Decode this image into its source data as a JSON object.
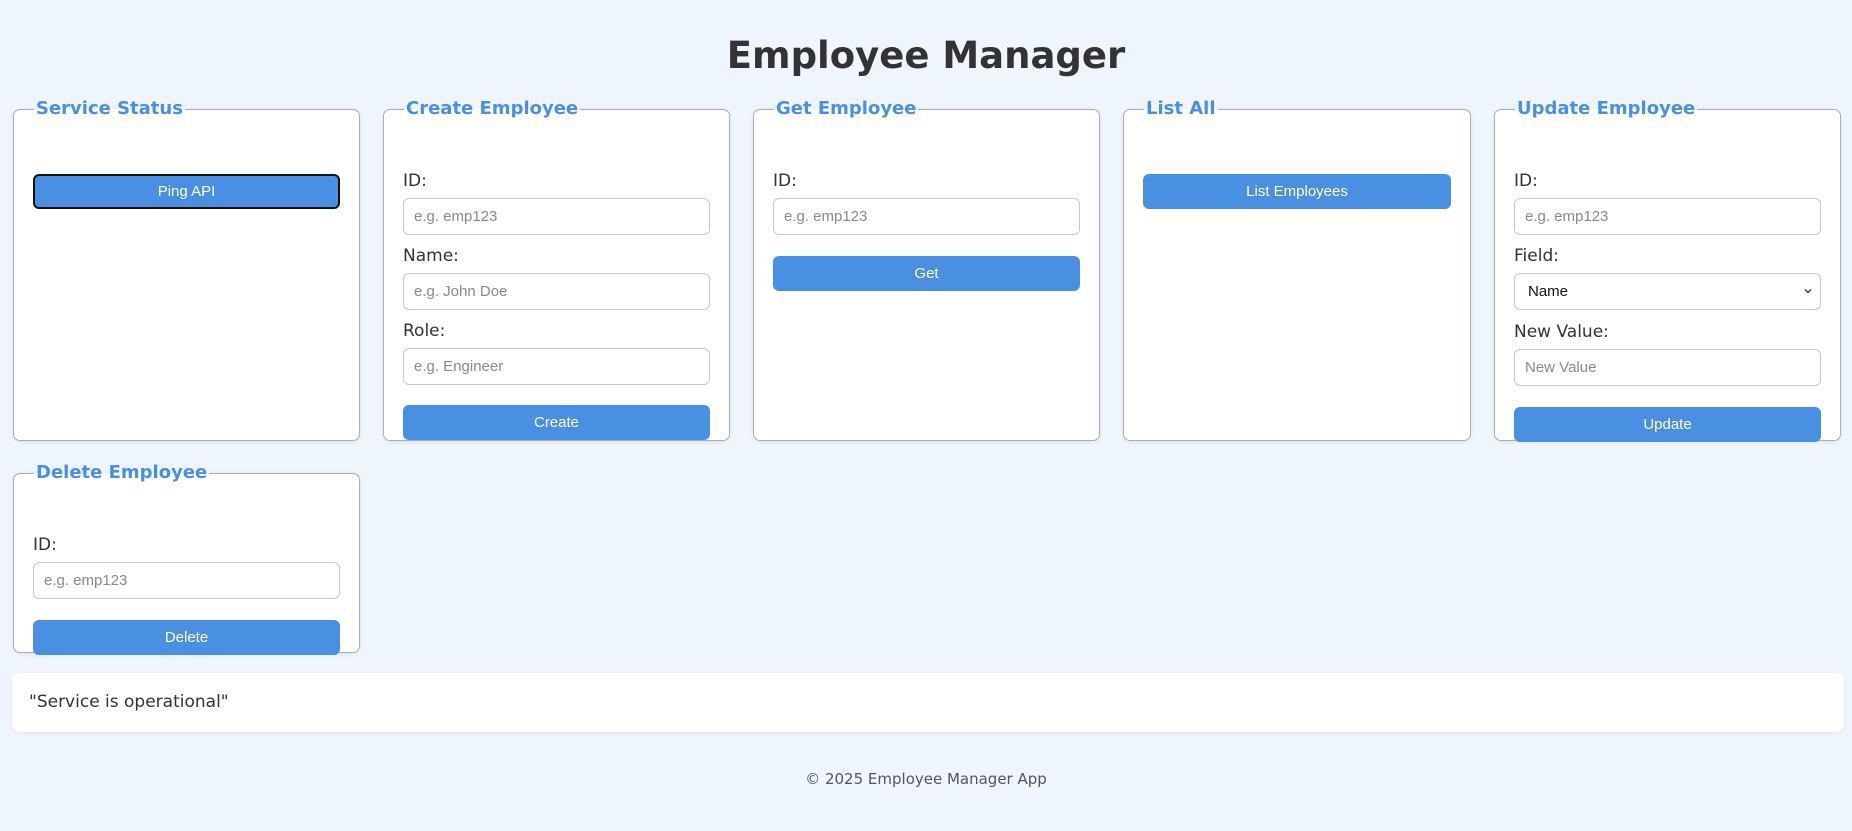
{
  "app": {
    "title": "Employee Manager",
    "accent_color": "#4a90e2",
    "background_color": "#eff5fd"
  },
  "service_status": {
    "legend": "Service Status",
    "ping_label": "Ping API"
  },
  "create": {
    "legend": "Create Employee",
    "id_label": "ID:",
    "id_placeholder": "e.g. emp123",
    "name_label": "Name:",
    "name_placeholder": "e.g. John Doe",
    "role_label": "Role:",
    "role_placeholder": "e.g. Engineer",
    "button_label": "Create"
  },
  "get": {
    "legend": "Get Employee",
    "id_label": "ID:",
    "id_placeholder": "e.g. emp123",
    "button_label": "Get"
  },
  "list_all": {
    "legend": "List All",
    "button_label": "List Employees"
  },
  "update": {
    "legend": "Update Employee",
    "id_label": "ID:",
    "id_placeholder": "e.g. emp123",
    "field_label": "Field:",
    "field_selected": "Name",
    "field_icon": "chevron-down-icon",
    "value_label": "New Value:",
    "value_placeholder": "New Value",
    "button_label": "Update"
  },
  "delete": {
    "legend": "Delete Employee",
    "id_label": "ID:",
    "id_placeholder": "e.g. emp123",
    "button_label": "Delete"
  },
  "output": {
    "text": "\"Service is operational\""
  },
  "footer": {
    "text": "© 2025 Employee Manager App"
  }
}
